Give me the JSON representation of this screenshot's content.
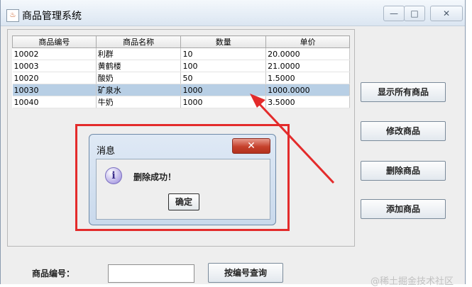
{
  "window": {
    "title": "商品管理系统",
    "icon": "java-cup-icon",
    "controls": {
      "minimize": "—",
      "maximize": "□",
      "close": "✕"
    }
  },
  "table": {
    "columns": [
      "商品编号",
      "商品名称",
      "数量",
      "单价"
    ],
    "rows": [
      [
        "10002",
        "利群",
        "10",
        "20.0000"
      ],
      [
        "10003",
        "黄鹤楼",
        "100",
        "21.0000"
      ],
      [
        "10020",
        "酸奶",
        "50",
        "1.5000"
      ],
      [
        "10030",
        "矿泉水",
        "1000",
        "1000.0000"
      ],
      [
        "10040",
        "牛奶",
        "1000",
        "3.5000"
      ]
    ],
    "selected_row": 3
  },
  "actions": {
    "show_all": "显示所有商品",
    "modify": "修改商品",
    "delete": "删除商品",
    "add": "添加商品"
  },
  "search": {
    "label": "商品编号：",
    "value": "",
    "button": "按编号查询"
  },
  "dialog": {
    "title": "消息",
    "close": "✕",
    "icon": "info-icon",
    "message": "删除成功！",
    "ok": "确定"
  },
  "watermark": "@稀土掘金技术社区",
  "colors": {
    "annotation": "#e32b2b",
    "selected_row": "#b8cfe5"
  }
}
